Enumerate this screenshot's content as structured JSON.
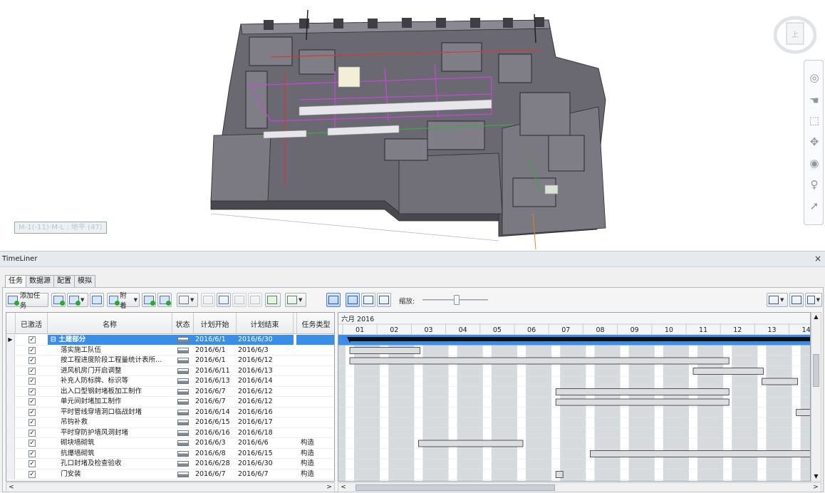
{
  "viewport": {
    "view_label": "M-1(-11)-M-L : 地平 (47)",
    "viewcube_face": "上"
  },
  "timeliner": {
    "title": "TimeLiner",
    "close_glyph": "×",
    "tabs": [
      "任务",
      "数据源",
      "配置",
      "模拟"
    ],
    "toolbar": {
      "add_task_label": "添加任务",
      "attach_label": "附着",
      "zoom_label": "缩放:"
    },
    "grid": {
      "columns": [
        "已激活",
        "名称",
        "状态",
        "计划开始",
        "计划结束",
        "任务类型"
      ],
      "rows": [
        {
          "name": "土建部分",
          "start": "2016/6/1",
          "end": "2016/6/30",
          "type": "",
          "group": true
        },
        {
          "name": "落实施工队伍",
          "start": "2016/6/1",
          "end": "2016/6/3",
          "type": ""
        },
        {
          "name": "按工程进度阶段工程量统计表所…",
          "start": "2016/6/1",
          "end": "2016/6/12",
          "type": ""
        },
        {
          "name": "进风机房门开启调整",
          "start": "2016/6/11",
          "end": "2016/6/13",
          "type": ""
        },
        {
          "name": "补充人防标牌、标识等",
          "start": "2016/6/13",
          "end": "2016/6/14",
          "type": ""
        },
        {
          "name": "出入口型钢封堵板加工制作",
          "start": "2016/6/7",
          "end": "2016/6/12",
          "type": ""
        },
        {
          "name": "单元间封堵加工制作",
          "start": "2016/6/7",
          "end": "2016/6/12",
          "type": ""
        },
        {
          "name": "平时管线穿墙洞口临战封堵",
          "start": "2016/6/14",
          "end": "2016/6/16",
          "type": ""
        },
        {
          "name": "吊钩补救",
          "start": "2016/6/15",
          "end": "2016/6/17",
          "type": ""
        },
        {
          "name": "平时穿防护墙风洞封堵",
          "start": "2016/6/16",
          "end": "2016/6/18",
          "type": ""
        },
        {
          "name": "砌块墙砌筑",
          "start": "2016/6/3",
          "end": "2016/6/6",
          "type": "构造"
        },
        {
          "name": "抗爆墙砌筑",
          "start": "2016/6/8",
          "end": "2016/6/15",
          "type": "构造"
        },
        {
          "name": "孔口封堵及检查验收",
          "start": "2016/6/28",
          "end": "2016/6/30",
          "type": "构造"
        },
        {
          "name": "门安装",
          "start": "2016/6/7",
          "end": "2016/6/7",
          "type": "构造"
        }
      ]
    },
    "gantt": {
      "month_label": "六月 2016",
      "days": [
        "01",
        "02",
        "03",
        "04",
        "05",
        "06",
        "07",
        "08",
        "09",
        "10",
        "11",
        "12",
        "13",
        "14"
      ]
    }
  }
}
